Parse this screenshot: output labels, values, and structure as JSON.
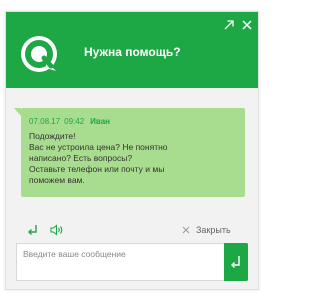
{
  "header": {
    "title": "Нужна помощь?",
    "logo_icon": "chat-logo-icon",
    "expand_icon": "expand-arrow-icon",
    "close_icon": "close-icon"
  },
  "message": {
    "date": "07.08.17",
    "time": "09:42",
    "author": "Иван",
    "lines": [
      "Подождите!",
      "Вас не устроила цена? Не понятно",
      "написано? Есть вопросы?",
      "Оставьте телефон или почту и мы",
      "поможем вам."
    ]
  },
  "toolbar": {
    "reply_icon": "reply-arrow-icon",
    "sound_icon": "speaker-icon",
    "close_label": "Закрыть"
  },
  "input": {
    "placeholder": "Введите ваше сообщение",
    "value": "",
    "send_icon": "send-enter-icon"
  },
  "colors": {
    "brand_green": "#1ea745",
    "bubble_green": "#a8dc8e",
    "background": "#f2f2f2"
  }
}
